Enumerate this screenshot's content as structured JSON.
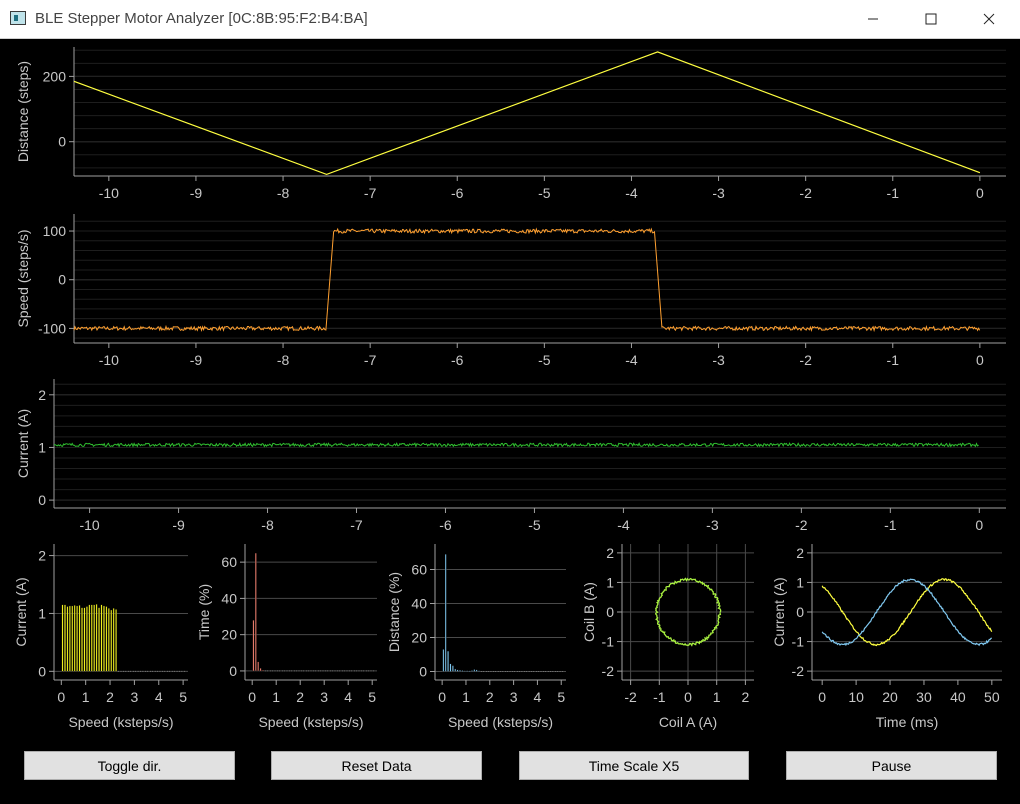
{
  "window": {
    "title": "BLE Stepper Motor Analyzer [0C:8B:95:F2:B4:BA]",
    "minimize_glyph": "─",
    "maximize_glyph": "☐",
    "close_glyph": "✕"
  },
  "colors": {
    "distance": "#ffff40",
    "speed": "#ffa030",
    "current": "#30c030",
    "hist_current": "#f0f020",
    "hist_time": "#f08070",
    "hist_distance": "#80c8f0",
    "coil": "#a8f040",
    "coil_a": "#ffff40",
    "coil_b": "#80c8f0",
    "axis_text": "#c8c8c8",
    "grid": "#3a3a3a"
  },
  "buttons": {
    "toggle_dir": "Toggle dir.",
    "reset_data": "Reset Data",
    "time_scale": "Time Scale X5",
    "pause": "Pause"
  },
  "chart_data": [
    {
      "id": "distance",
      "type": "line",
      "ylabel": "Distance (steps)",
      "xlim": [
        -10.4,
        0.3
      ],
      "ylim": [
        -105,
        290
      ],
      "xticks": [
        -10,
        -9,
        -8,
        -7,
        -6,
        -5,
        -4,
        -3,
        -2,
        -1,
        0
      ],
      "yticks": [
        0,
        200
      ],
      "x": [
        -10.4,
        -7.5,
        -3.7,
        0
      ],
      "y": [
        185,
        -100,
        275,
        -95
      ]
    },
    {
      "id": "speed",
      "type": "line",
      "ylabel": "Speed (steps/s)",
      "xlim": [
        -10.4,
        0.3
      ],
      "ylim": [
        -130,
        135
      ],
      "xticks": [
        -10,
        -9,
        -8,
        -7,
        -6,
        -5,
        -4,
        -3,
        -2,
        -1,
        0
      ],
      "yticks": [
        -100,
        0,
        100
      ],
      "segments": [
        {
          "x_start": -10.4,
          "x_end": -7.5,
          "value": -100
        },
        {
          "x_start": -7.42,
          "x_end": -3.73,
          "value": 100
        },
        {
          "x_start": -3.65,
          "x_end": 0,
          "value": -100
        }
      ]
    },
    {
      "id": "current",
      "type": "line",
      "ylabel": "Current (A)",
      "xlim": [
        -10.4,
        0.3
      ],
      "ylim": [
        -0.15,
        2.3
      ],
      "xticks": [
        -10,
        -9,
        -8,
        -7,
        -6,
        -5,
        -4,
        -3,
        -2,
        -1,
        0
      ],
      "yticks": [
        0,
        1,
        2
      ],
      "value": 1.05,
      "x_range": [
        -10.4,
        0
      ]
    },
    {
      "id": "hist-current",
      "type": "bar",
      "xlabel": "Speed (ksteps/s)",
      "ylabel": "Current (A)",
      "xlim": [
        -0.3,
        5.2
      ],
      "ylim": [
        -0.15,
        2.2
      ],
      "xticks": [
        0,
        1,
        2,
        3,
        4,
        5
      ],
      "yticks": [
        0,
        1,
        2
      ],
      "bin_width": 0.1,
      "x": [
        0.1,
        0.2,
        0.3,
        0.4,
        0.5,
        0.6,
        0.7,
        0.8,
        0.9,
        1.0,
        1.1,
        1.2,
        1.3,
        1.4,
        1.5,
        1.6,
        1.7,
        1.8,
        1.9,
        2.0,
        2.1,
        2.2,
        2.3
      ],
      "values": [
        1.15,
        1.15,
        1.12,
        1.13,
        1.13,
        1.14,
        1.13,
        1.14,
        1.1,
        1.1,
        1.12,
        1.15,
        1.15,
        1.15,
        1.16,
        1.1,
        1.15,
        1.13,
        1.12,
        1.09,
        1.06,
        1.09,
        1.07
      ]
    },
    {
      "id": "hist-time",
      "type": "bar",
      "xlabel": "Speed (ksteps/s)",
      "ylabel": "Time (%)",
      "xlim": [
        -0.3,
        5.2
      ],
      "ylim": [
        -5,
        70
      ],
      "xticks": [
        0,
        1,
        2,
        3,
        4,
        5
      ],
      "yticks": [
        0,
        20,
        40,
        60
      ],
      "bin_width": 0.1,
      "x": [
        0.1,
        0.2,
        0.3,
        0.4,
        0.5
      ],
      "values": [
        28,
        65,
        5,
        1.5,
        0.5
      ]
    },
    {
      "id": "hist-distance",
      "type": "bar",
      "xlabel": "Speed (ksteps/s)",
      "ylabel": "Distance (%)",
      "xlim": [
        -0.3,
        5.2
      ],
      "ylim": [
        -5,
        75
      ],
      "xticks": [
        0,
        1,
        2,
        3,
        4,
        5
      ],
      "yticks": [
        0,
        20,
        40,
        60
      ],
      "bin_width": 0.1,
      "x": [
        0.1,
        0.2,
        0.3,
        0.4,
        0.5,
        0.6,
        0.7,
        0.8,
        0.9,
        1.0,
        1.1,
        1.2,
        1.3,
        1.4,
        1.5,
        1.6
      ],
      "values": [
        13,
        69,
        12,
        4.5,
        3.5,
        1.5,
        1,
        0.8,
        0.6,
        0.5,
        0.5,
        0.4,
        0.6,
        1.2,
        1.0,
        0.5
      ]
    },
    {
      "id": "coil-xy",
      "type": "scatter",
      "xlabel": "Coil A (A)",
      "ylabel": "Coil B (A)",
      "xlim": [
        -2.3,
        2.3
      ],
      "ylim": [
        -2.3,
        2.3
      ],
      "xticks": [
        -2,
        -1,
        0,
        1,
        2
      ],
      "yticks": [
        -2,
        -1,
        0,
        1,
        2
      ],
      "radius": 1.1,
      "center": [
        0,
        0
      ]
    },
    {
      "id": "coil-time",
      "type": "line",
      "xlabel": "Time (ms)",
      "ylabel": "Current (A)",
      "xlim": [
        -3,
        53
      ],
      "ylim": [
        -2.3,
        2.3
      ],
      "xticks": [
        0,
        10,
        20,
        30,
        40,
        50
      ],
      "yticks": [
        -2,
        -1,
        0,
        1,
        2
      ],
      "series": [
        {
          "id": "coil-a",
          "amplitude": 1.1,
          "period_ms": 40,
          "peak_ms": 36,
          "x_range": [
            0,
            50
          ]
        },
        {
          "id": "coil-b",
          "amplitude": 1.1,
          "period_ms": 40,
          "peak_ms": 26,
          "x_range": [
            0,
            50
          ]
        }
      ]
    }
  ]
}
